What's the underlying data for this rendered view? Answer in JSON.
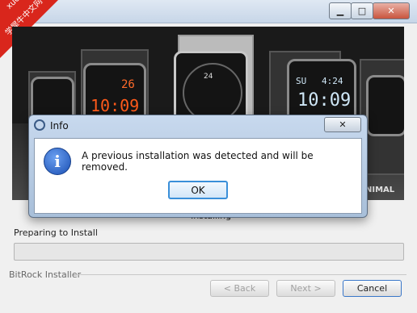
{
  "window": {
    "title_partial": "p",
    "minimize_glyph": "▁",
    "maximize_glyph": "□",
    "close_glyph": "✕"
  },
  "watermark": {
    "line1": "xuexiniu",
    "line2": "学犀牛中文网",
    "color": "#d9261c"
  },
  "banner": {
    "watch_left_time": "10:09",
    "watch_left_date": "26",
    "watch_right_day": "SU",
    "watch_right_time": "10:09",
    "watch_right_small": "4:24",
    "center_dial_number": "24",
    "brand_text": "NIMAL"
  },
  "installer": {
    "status_label": "Installing",
    "task_label": "Preparing to Install",
    "progress_percent": 0,
    "progress_color": "#6bd36b",
    "footer_brand": "BitRock Installer",
    "buttons": {
      "back": "< Back",
      "next": "Next >",
      "cancel": "Cancel"
    }
  },
  "dialog": {
    "title": "Info",
    "close_glyph": "✕",
    "icon": "info-icon",
    "icon_glyph": "i",
    "message": "A previous installation was detected and will be removed.",
    "ok_label": "OK"
  }
}
